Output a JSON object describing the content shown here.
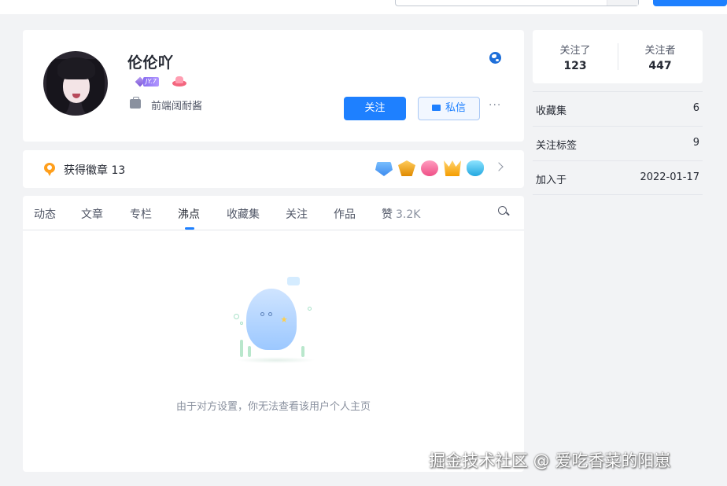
{
  "profile": {
    "username": "伦伦吖",
    "level_badge": "JY.7",
    "job": "前端阔耐酱",
    "follow_label": "关注",
    "message_label": "私信",
    "more_label": "···"
  },
  "badges": {
    "label": "获得徽章 13"
  },
  "tabs": [
    {
      "label": "动态"
    },
    {
      "label": "文章"
    },
    {
      "label": "专栏"
    },
    {
      "label": "沸点"
    },
    {
      "label": "收藏集"
    },
    {
      "label": "关注"
    },
    {
      "label": "作品"
    },
    {
      "label": "赞",
      "count": "3.2K"
    }
  ],
  "active_tab": "沸点",
  "empty_state": {
    "message": "由于对方设置，你无法查看该用户个人主页"
  },
  "follow_stats": {
    "following_label": "关注了",
    "following_value": "123",
    "followers_label": "关注者",
    "followers_value": "447"
  },
  "stats": [
    {
      "label": "收藏集",
      "value": "6"
    },
    {
      "label": "关注标签",
      "value": "9"
    },
    {
      "label": "加入于",
      "value": "2022-01-17"
    }
  ],
  "watermark": "掘金技术社区 @ 爱吃香菜的阳崽",
  "colors": {
    "accent": "#1e80ff",
    "background": "#f2f3f5",
    "text_primary": "#252933",
    "text_secondary": "#8a919f"
  },
  "icons": [
    "briefcase-icon",
    "globe-icon",
    "mail-icon",
    "medal-icon",
    "chevron-right-icon",
    "search-icon"
  ]
}
